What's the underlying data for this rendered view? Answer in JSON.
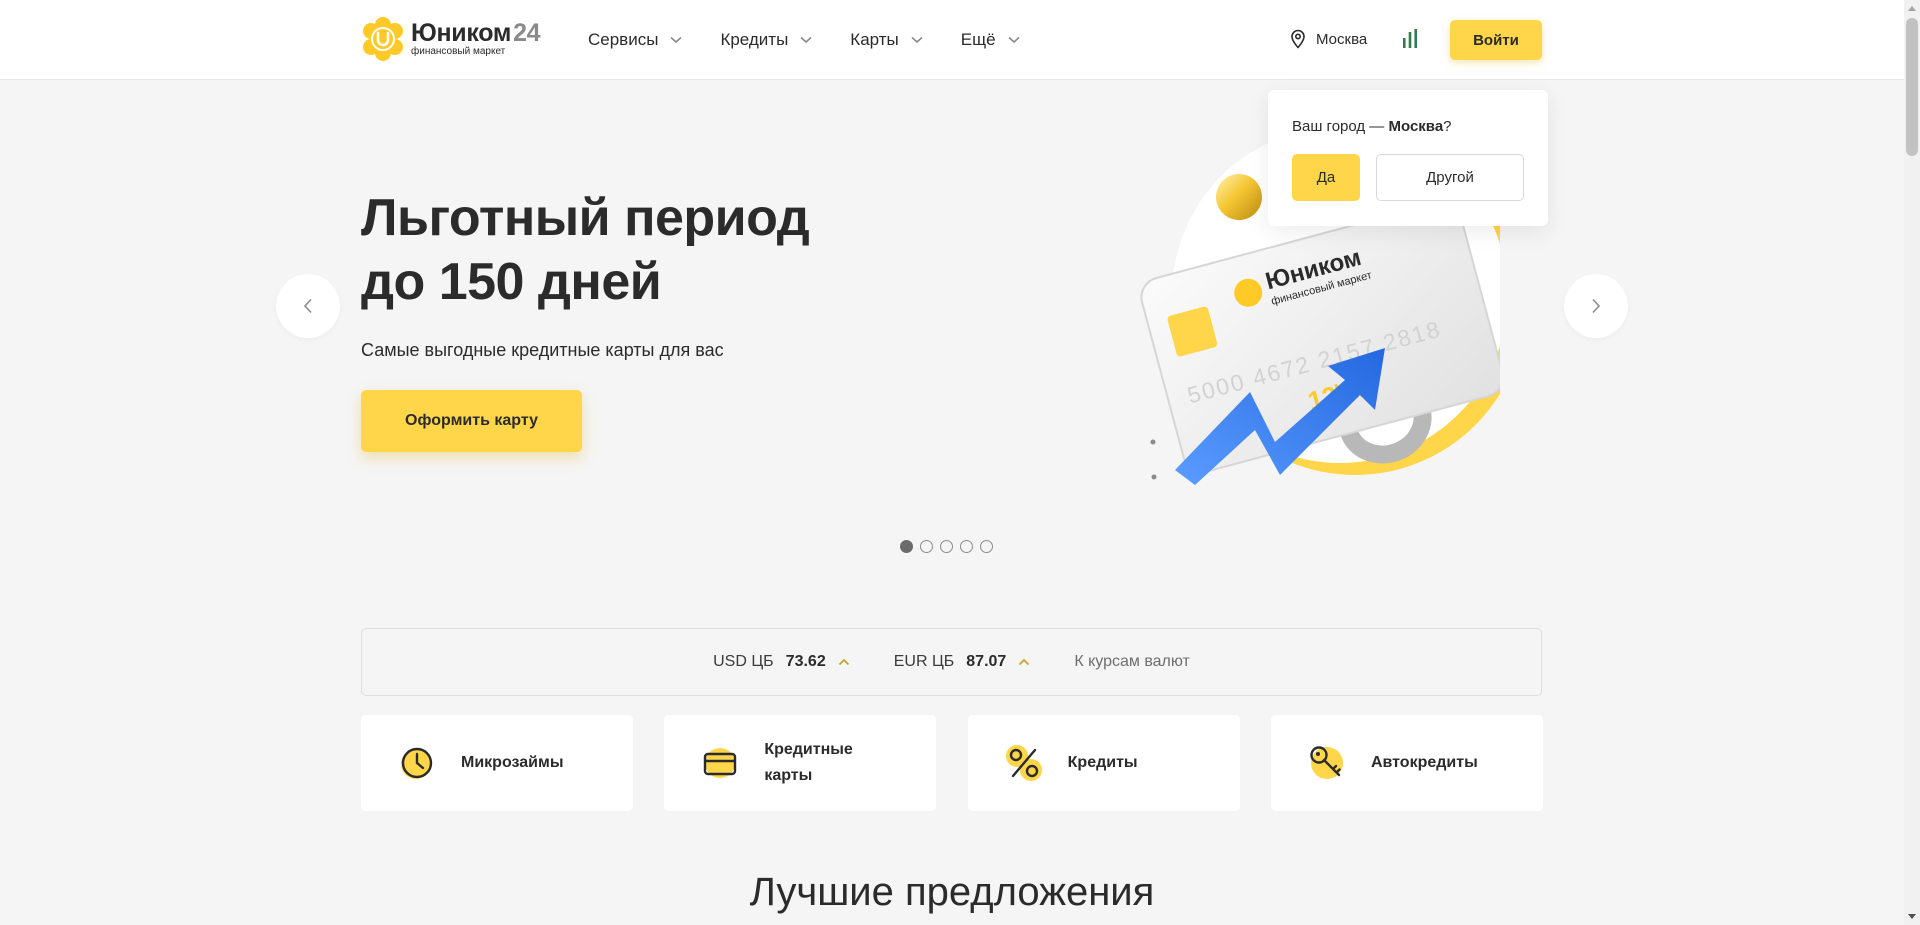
{
  "header": {
    "logo_name": "Юником",
    "logo_number": "24",
    "logo_tagline": "финансовый маркет",
    "nav": [
      {
        "label": "Сервисы"
      },
      {
        "label": "Кредиты"
      },
      {
        "label": "Карты"
      },
      {
        "label": "Ещё"
      }
    ],
    "city": "Москва",
    "login_label": "Войти",
    "icons": {
      "city": "map-pin-icon",
      "stats": "bar-chart-icon",
      "nav_chevron": "chevron-down-icon"
    }
  },
  "hero": {
    "title_line1": "Льготный период",
    "title_line2": "до 150 дней",
    "subtitle": "Самые выгодные кредитные карты для вас",
    "cta_label": "Оформить карту",
    "slide_count": 5,
    "active_slide": 1,
    "card": {
      "brand": "Юником",
      "tagline": "финансовый маркет",
      "number": "5000 4672 2157 2818",
      "expiry": "12\\22"
    }
  },
  "city_popup": {
    "question_prefix": "Ваш город — ",
    "city": "Москва",
    "question_suffix": "?",
    "yes_label": "Да",
    "other_label": "Другой"
  },
  "currency": {
    "usd_label": "USD ЦБ",
    "usd_value": "73.62",
    "eur_label": "EUR ЦБ",
    "eur_value": "87.07",
    "link_label": "К курсам валют",
    "trend_color": "#c9a227"
  },
  "categories": [
    {
      "label": "Микрозаймы",
      "icon": "clock-icon"
    },
    {
      "label": "Кредитные карты",
      "icon": "credit-card-icon"
    },
    {
      "label": "Кредиты",
      "icon": "percent-icon"
    },
    {
      "label": "Автокредиты",
      "icon": "key-icon"
    }
  ],
  "section_title": "Лучшие предложения",
  "colors": {
    "accent": "#ffd54a",
    "text": "#2b2b2b",
    "background": "#f5f5f5"
  }
}
